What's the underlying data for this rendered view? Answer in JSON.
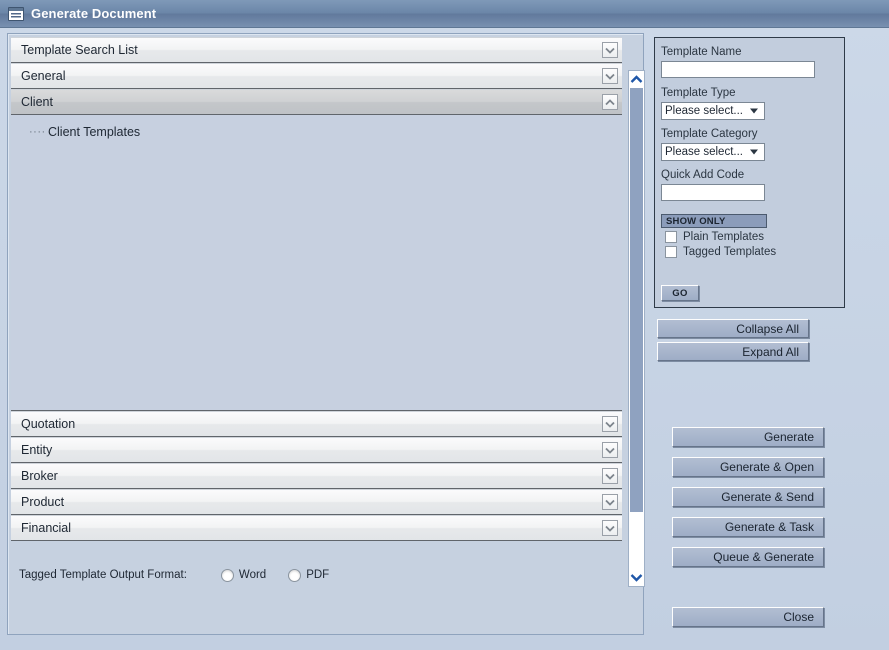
{
  "window": {
    "title": "Generate Document",
    "icon": "document-window-icon"
  },
  "accordion": {
    "sections": [
      {
        "label": "Template Search List",
        "state": "collapsed",
        "chevron": "chevron-down-icon"
      },
      {
        "label": "General",
        "state": "collapsed",
        "chevron": "chevron-down-icon"
      },
      {
        "label": "Client",
        "state": "expanded",
        "chevron": "chevron-up-icon"
      },
      {
        "label": "Quotation",
        "state": "collapsed",
        "chevron": "chevron-down-icon"
      },
      {
        "label": "Entity",
        "state": "collapsed",
        "chevron": "chevron-down-icon"
      },
      {
        "label": "Broker",
        "state": "collapsed",
        "chevron": "chevron-down-icon"
      },
      {
        "label": "Product",
        "state": "collapsed",
        "chevron": "chevron-down-icon"
      },
      {
        "label": "Financial",
        "state": "collapsed",
        "chevron": "chevron-down-icon"
      }
    ],
    "client_tree": [
      {
        "label": "Client Templates",
        "connector": "·····"
      }
    ]
  },
  "scrollbar": {
    "up_arrow": "chevron-up-icon",
    "down_arrow": "chevron-down-icon"
  },
  "output_format": {
    "label": "Tagged Template Output Format:",
    "options": [
      {
        "label": "Word",
        "selected": false
      },
      {
        "label": "PDF",
        "selected": false
      }
    ]
  },
  "search_panel": {
    "template_name": {
      "label": "Template Name",
      "value": "",
      "placeholder": ""
    },
    "template_type": {
      "label": "Template Type",
      "value": "Please select..."
    },
    "template_category": {
      "label": "Template Category",
      "value": "Please select..."
    },
    "quick_add_code": {
      "label": "Quick Add Code",
      "value": "",
      "placeholder": ""
    },
    "show_only": {
      "header": "SHOW ONLY",
      "checkboxes": [
        {
          "label": "Plain Templates",
          "checked": false
        },
        {
          "label": "Tagged Templates",
          "checked": false
        }
      ]
    },
    "go_label": "GO"
  },
  "tree_controls": {
    "collapse_all": "Collapse All",
    "expand_all": "Expand All"
  },
  "actions": {
    "generate": "Generate",
    "generate_open": "Generate & Open",
    "generate_send": "Generate & Send",
    "generate_task": "Generate & Task",
    "queue_generate": "Queue & Generate",
    "close": "Close"
  },
  "colors": {
    "titlebar": "#6b86a8",
    "panel_bg": "#c6d1e0",
    "button_face": "#9eadc6",
    "accent_blue": "#8fa2c0",
    "show_only_bar": "#8b9cba"
  }
}
